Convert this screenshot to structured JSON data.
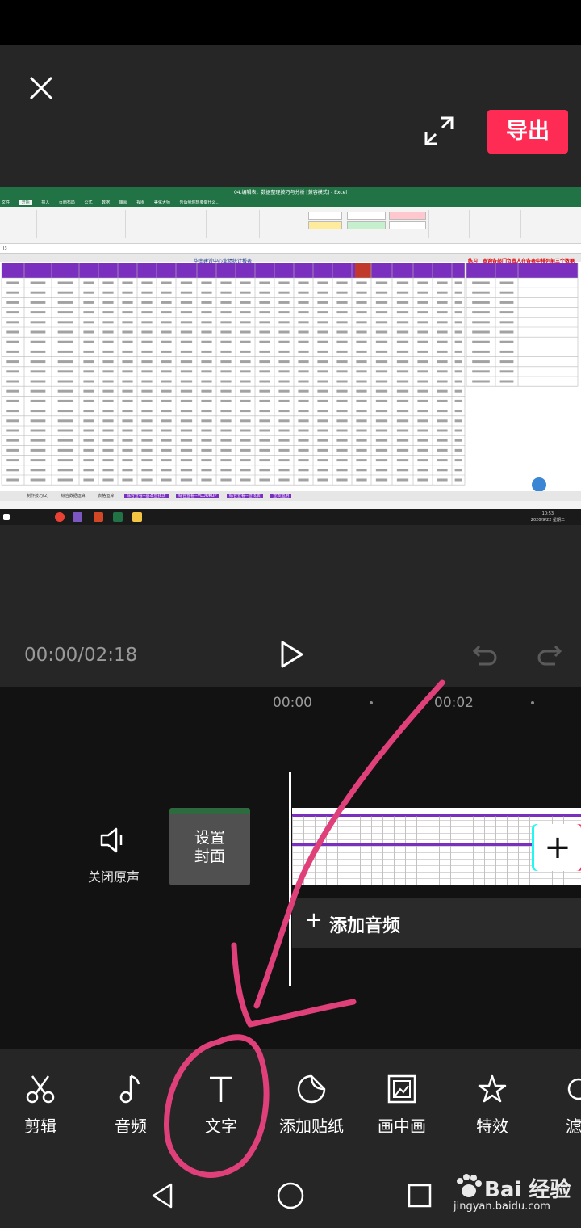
{
  "header": {
    "export_label": "导出"
  },
  "preview": {
    "window_title": "04.编辑表：数据整理技巧与分析 [兼容模式] - Excel",
    "ribbon_tabs": [
      "文件",
      "开始",
      "插入",
      "页面布局",
      "公式",
      "数据",
      "审阅",
      "视图",
      "美化大师",
      "告诉我你想要做什么..."
    ],
    "formula_cell": "J3",
    "sheet_title": "华南建设中心业绩统计报表",
    "sheet_hint": "练习：查询各部门负责人在各表中排列前三个数据",
    "sheet_tabs": [
      "制作技巧(2)",
      "综合数据运算",
      "表格运算",
      "综合查看--基本查找法",
      "综合查看--VLOOKUP",
      "综合查看--查找表",
      "查表运用"
    ],
    "clock_time": "10:53",
    "clock_date": "2020/9/22 星期二"
  },
  "player": {
    "timecode": "00:00/02:18"
  },
  "timeline": {
    "ruler": [
      "00:00",
      "00:02"
    ],
    "mute_label": "关闭原声",
    "cover_label": "设置\n封面",
    "add_clip_symbol": "+",
    "add_audio_plus": "+",
    "add_audio_label": "添加音频"
  },
  "toolbar": {
    "items": [
      {
        "label": "剪辑",
        "icon": "scissors-icon"
      },
      {
        "label": "音频",
        "icon": "music-note-icon"
      },
      {
        "label": "文字",
        "icon": "text-icon"
      },
      {
        "label": "添加贴纸",
        "icon": "sticker-icon"
      },
      {
        "label": "画中画",
        "icon": "picture-in-picture-icon"
      },
      {
        "label": "特效",
        "icon": "star-effect-icon"
      },
      {
        "label": "滤",
        "icon": "filter-icon"
      }
    ]
  },
  "watermark": {
    "brand": "Bai 经验",
    "url": "jingyan.baidu.com"
  },
  "colors": {
    "accent": "#fe2c55",
    "annotation": "#e0407a",
    "excel_green": "#217346",
    "header_purple": "#7b2fbe"
  }
}
